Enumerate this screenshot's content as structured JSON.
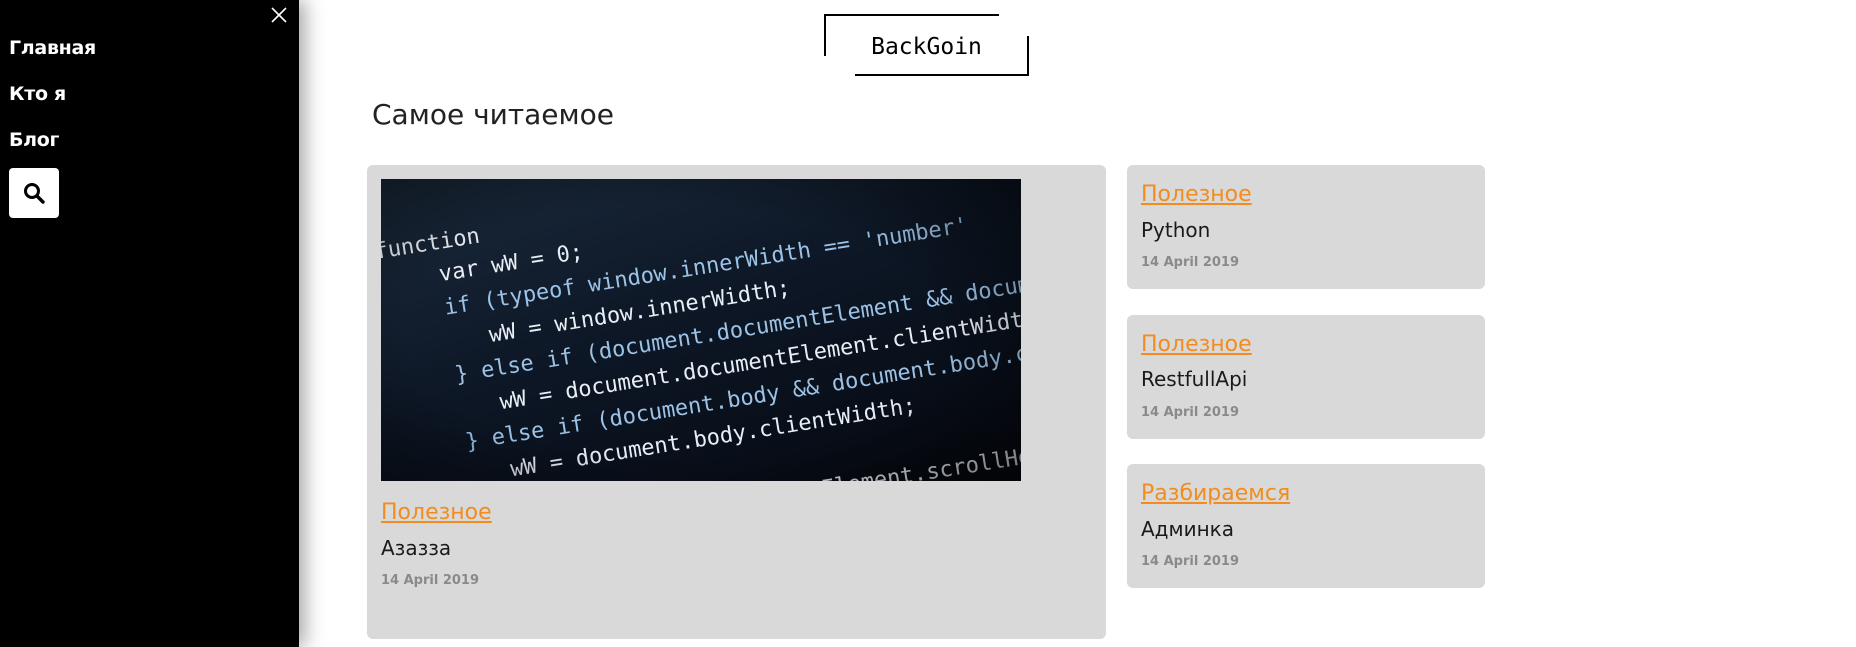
{
  "sidebar": {
    "close_icon": "close-icon",
    "items": [
      {
        "label": "Главная"
      },
      {
        "label": "Кто я"
      },
      {
        "label": "Блог"
      }
    ],
    "search_icon": "search-icon"
  },
  "header": {
    "logo_text": "BackGoin"
  },
  "main": {
    "section_title": "Самое читаемое",
    "featured": {
      "image_icon": "code-screenshot-image",
      "category": "Полезное",
      "title": "Азазза",
      "date": "14 April 2019"
    },
    "posts": [
      {
        "category": "Полезное",
        "title": "Python",
        "date": "14 April 2019"
      },
      {
        "category": "Полезное",
        "title": "RestfullApi",
        "date": "14 April 2019"
      },
      {
        "category": "Разбираемся",
        "title": "Админка",
        "date": "14 April 2019"
      }
    ]
  },
  "colors": {
    "sidebar_bg": "#000000",
    "card_bg": "#d9d9d9",
    "accent": "#f28c1e",
    "date_text": "#8a8a8a"
  }
}
